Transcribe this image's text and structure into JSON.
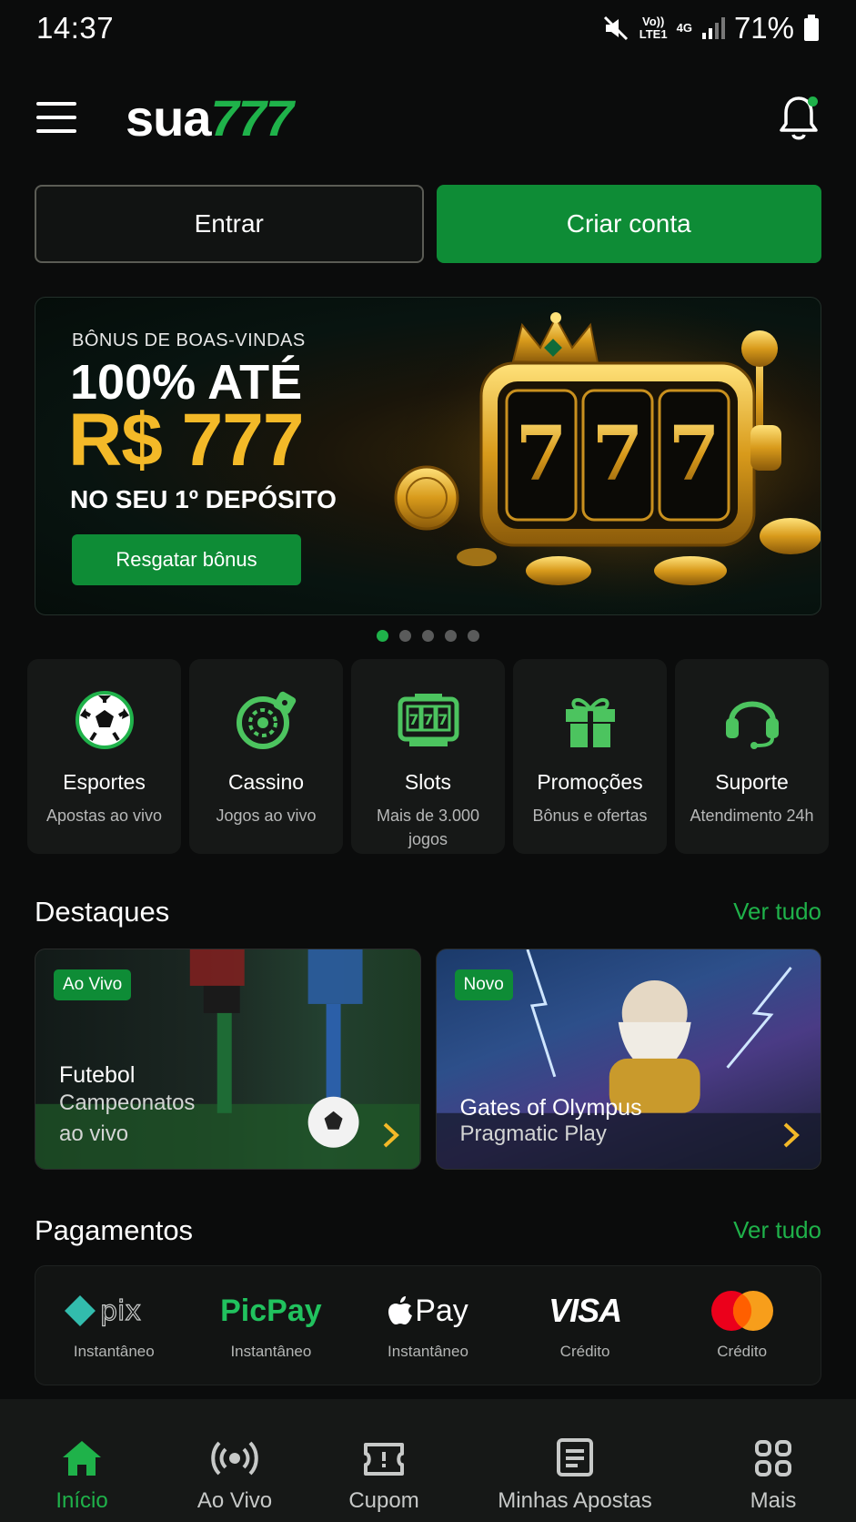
{
  "status_bar": {
    "time": "14:37",
    "volte": "Vo))",
    "lte": "LTE1",
    "network": "4G",
    "battery": "71%"
  },
  "header": {
    "logo_part1": "sua",
    "logo_part2": "777",
    "menu_icon": "hamburger-menu-icon",
    "notification_icon": "bell-icon"
  },
  "auth": {
    "login_label": "Entrar",
    "signup_label": "Criar conta"
  },
  "banner": {
    "kicker": "BÔNUS DE BOAS-VINDAS",
    "line1": "100% ATÉ",
    "line2": "R$ 777",
    "line3": "NO SEU 1º DEPÓSITO",
    "cta": "Resgatar bônus",
    "slot_digits": [
      "7",
      "7",
      "7"
    ],
    "carousel_total": 5,
    "carousel_active": 1
  },
  "categories": [
    {
      "title": "Esportes",
      "sub": "Apostas ao vivo",
      "icon": "soccer-ball-icon"
    },
    {
      "title": "Cassino",
      "sub": "Jogos ao vivo",
      "icon": "roulette-icon"
    },
    {
      "title": "Slots",
      "sub": "Mais de 3.000 jogos",
      "icon": "slot-machine-icon"
    },
    {
      "title": "Promoções",
      "sub": "Bônus e ofertas",
      "icon": "gift-icon"
    },
    {
      "title": "Suporte",
      "sub": "Atendimento 24h",
      "icon": "headset-icon"
    }
  ],
  "highlights": {
    "title": "Destaques",
    "see_all": "Ver tudo",
    "cards": [
      {
        "badge": "Ao Vivo",
        "title": "Futebol",
        "sub_line1": "Campeonatos",
        "sub_line2": "ao vivo"
      },
      {
        "badge": "Novo",
        "title": "Gates of Olympus",
        "sub_line1": "Pragmatic Play"
      }
    ]
  },
  "payments": {
    "title": "Pagamentos",
    "see_all": "Ver tudo",
    "methods": [
      {
        "name": "pix",
        "label": "Instantâneo"
      },
      {
        "name": "PicPay",
        "label": "Instantâneo"
      },
      {
        "name": "Pay",
        "label": "Instantâneo"
      },
      {
        "name": "VISA",
        "label": "Crédito"
      },
      {
        "name": "mastercard",
        "label": "Crédito"
      }
    ]
  },
  "bottom_nav": [
    {
      "label": "Início",
      "icon": "home-icon",
      "active": true
    },
    {
      "label": "Ao Vivo",
      "icon": "broadcast-icon",
      "active": false
    },
    {
      "label": "Cupom",
      "icon": "ticket-icon",
      "active": false
    },
    {
      "label": "Minhas Apostas",
      "icon": "receipt-icon",
      "active": false
    },
    {
      "label": "Mais",
      "icon": "grid-icon",
      "active": false
    }
  ],
  "colors": {
    "accent_green": "#1fb24a",
    "button_green": "#0e8c36",
    "gold": "#f3b928",
    "background": "#0b0c0c"
  }
}
